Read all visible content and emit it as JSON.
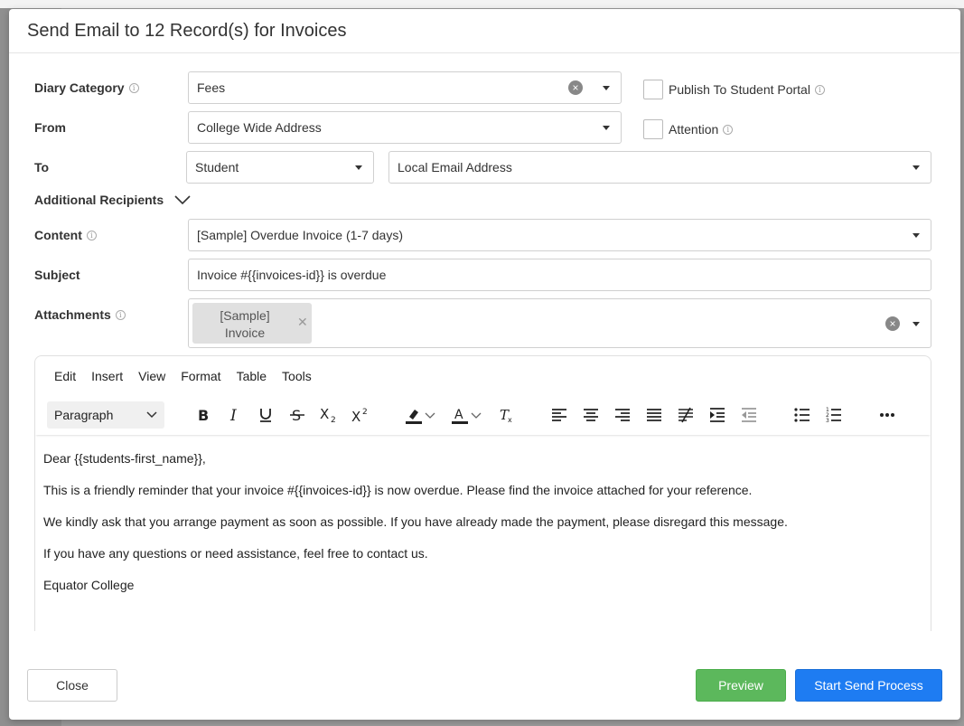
{
  "modal": {
    "title": "Send Email to 12 Record(s) for Invoices"
  },
  "form": {
    "diary_category": {
      "label": "Diary Category",
      "value": "Fees"
    },
    "from": {
      "label": "From",
      "value": "College Wide Address"
    },
    "to": {
      "label": "To",
      "recipient_type": "Student",
      "address_type": "Local Email Address"
    },
    "additional_recipients": {
      "label": "Additional Recipients"
    },
    "content": {
      "label": "Content",
      "value": "[Sample] Overdue Invoice (1-7 days)"
    },
    "subject": {
      "label": "Subject",
      "value": "Invoice #{{invoices-id}} is overdue"
    },
    "attachments": {
      "label": "Attachments",
      "chips": [
        "[Sample] Invoice"
      ],
      "chip_line1": "[Sample]",
      "chip_line2": "Invoice"
    },
    "publish_portal": {
      "label": "Publish To Student Portal",
      "checked": false
    },
    "attention": {
      "label": "Attention",
      "checked": false
    }
  },
  "editor": {
    "menu": [
      "Edit",
      "Insert",
      "View",
      "Format",
      "Table",
      "Tools"
    ],
    "block_format": "Paragraph",
    "toolbar_icons": [
      "bold-icon",
      "italic-icon",
      "underline-icon",
      "strikethrough-icon",
      "subscript-icon",
      "superscript-icon",
      "highlight-color-icon",
      "text-color-icon",
      "clear-formatting-icon",
      "align-left-icon",
      "align-center-icon",
      "align-right-icon",
      "justify-icon",
      "no-justify-icon",
      "indent-icon",
      "outdent-icon",
      "bullet-list-icon",
      "numbered-list-icon",
      "more-icon"
    ],
    "paragraphs": [
      "Dear {{students-first_name}},",
      "This is a friendly reminder that your invoice #{{invoices-id}} is now overdue. Please find the invoice attached for your reference.",
      "We kindly ask that you arrange payment as soon as possible. If you have already made the payment, please disregard this message.",
      "If you have any questions or need assistance, feel free to contact us.",
      "Equator College"
    ]
  },
  "footer": {
    "close_label": "Close",
    "preview_label": "Preview",
    "send_label": "Start Send Process"
  },
  "colors": {
    "preview": "#5cb85c",
    "send": "#1e7cf2"
  }
}
